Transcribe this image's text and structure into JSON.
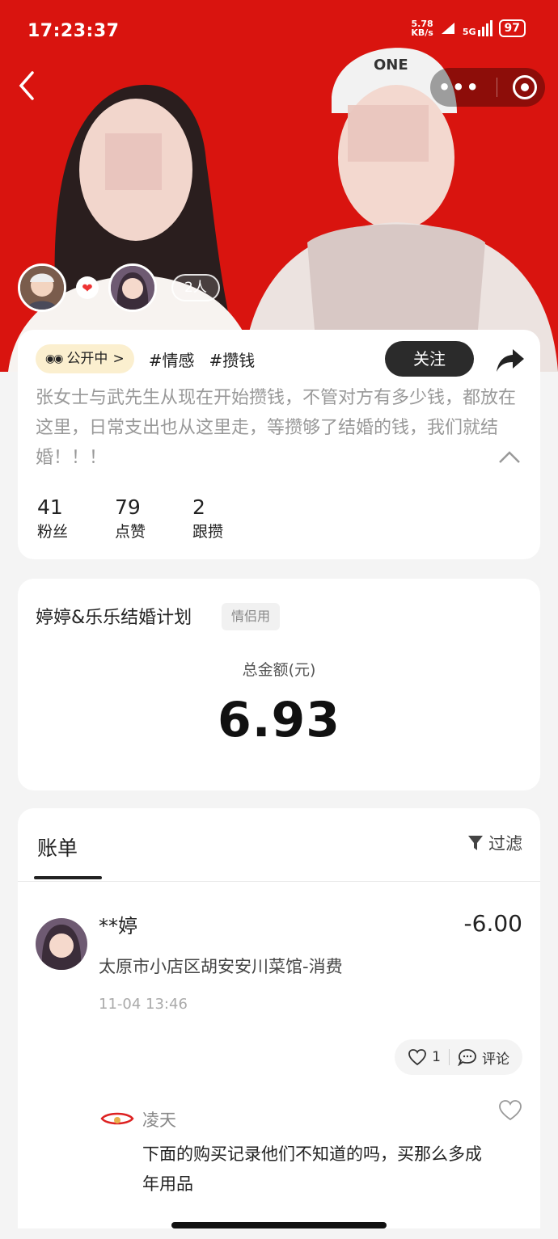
{
  "status_bar": {
    "time": "17:23:37",
    "net_speed_value": "5.78",
    "net_speed_unit": "KB/s",
    "network": "5G",
    "battery": "97"
  },
  "hero": {
    "member_count": "2人"
  },
  "info": {
    "visibility": "公开中",
    "tags": [
      "#情感",
      "#攒钱"
    ],
    "follow_label": "关注",
    "description": "张女士与武先生从现在开始攒钱，不管对方有多少钱，都放在这里，日常支出也从这里走，等攒够了结婚的钱，我们就结婚！！！",
    "stats": [
      {
        "value": "41",
        "label": "粉丝"
      },
      {
        "value": "79",
        "label": "点赞"
      },
      {
        "value": "2",
        "label": "跟攒"
      }
    ]
  },
  "plan": {
    "title": "婷婷&乐乐结婚计划",
    "badge": "情侣用",
    "total_label": "总金额(元)",
    "total_amount": "6.93"
  },
  "bill": {
    "tab_label": "账单",
    "filter_label": "过滤",
    "entry": {
      "name": "**婷",
      "amount": "-6.00",
      "description": "太原市小店区胡安安川菜馆-消费",
      "time": "11-04 13:46",
      "like_count": "1",
      "comment_label": "评论"
    },
    "comment": {
      "user": "凌天",
      "text": "下面的购买记录他们不知道的吗，买那么多成年用品"
    }
  },
  "colors": {
    "hero_red": "#d9140f",
    "follow_button": "#2b2b2b",
    "public_pill": "#fbefcf"
  }
}
